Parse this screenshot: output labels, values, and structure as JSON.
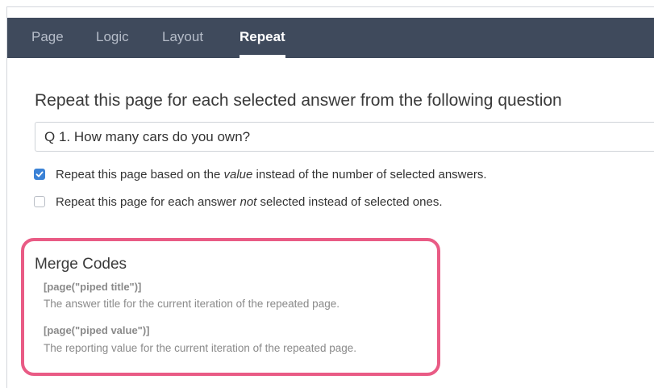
{
  "tabs": [
    {
      "label": "Page",
      "active": false
    },
    {
      "label": "Logic",
      "active": false
    },
    {
      "label": "Layout",
      "active": false
    },
    {
      "label": "Repeat",
      "active": true
    }
  ],
  "repeat": {
    "heading": "Repeat this page for each selected answer from the following question",
    "question_select": {
      "value": "Q 1. How many cars do you own?"
    },
    "options": [
      {
        "checked": true,
        "text_before": "Repeat this page based on the ",
        "text_emphasis": "value",
        "text_after": " instead of the number of selected answers."
      },
      {
        "checked": false,
        "text_before": "Repeat this page for each answer ",
        "text_emphasis": "not",
        "text_after": " selected instead of selected ones."
      }
    ]
  },
  "merge_codes": {
    "title": "Merge Codes",
    "items": [
      {
        "code": "[page(\"piped title\")]",
        "description": "The answer title for the current iteration of the repeated page."
      },
      {
        "code": "[page(\"piped value\")]",
        "description": "The reporting value for the current iteration of the repeated page."
      }
    ],
    "highlight_color": "#e95b85"
  },
  "colors": {
    "tabbar": "#3f4a5c",
    "checkbox_checked": "#3b82d6"
  }
}
